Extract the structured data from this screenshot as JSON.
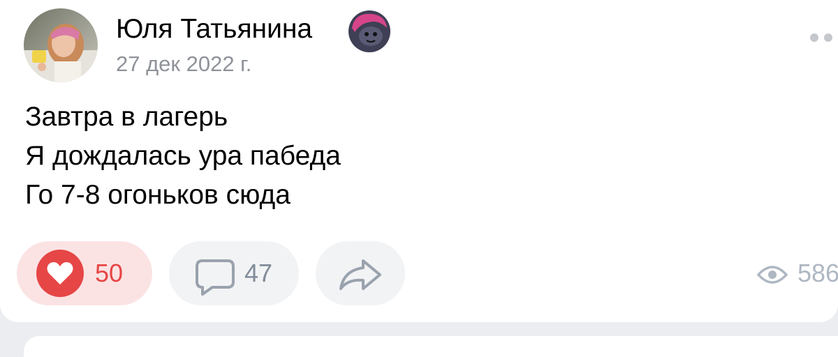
{
  "post": {
    "author_name": "Юля Татьянина",
    "date": "27 дек 2022 г.",
    "text_lines": [
      "Завтра в лагерь",
      "Я дождалась ура пабеда",
      "Го 7-8 огоньков сюда"
    ]
  },
  "actions": {
    "likes": "50",
    "comments": "47",
    "views": "586"
  },
  "icons": {
    "avatar": "user-avatar-photo",
    "badge": "profile-badge-sticker",
    "more": "more-dots-icon",
    "like": "heart-icon",
    "comment": "comment-bubble-icon",
    "share": "share-arrow-icon",
    "views": "eye-icon"
  },
  "colors": {
    "like_active": "#e64646",
    "like_bg": "#fbe3e4",
    "button_bg": "#f2f3f5",
    "secondary_text": "#8e9299",
    "muted_icon": "#818c99"
  }
}
